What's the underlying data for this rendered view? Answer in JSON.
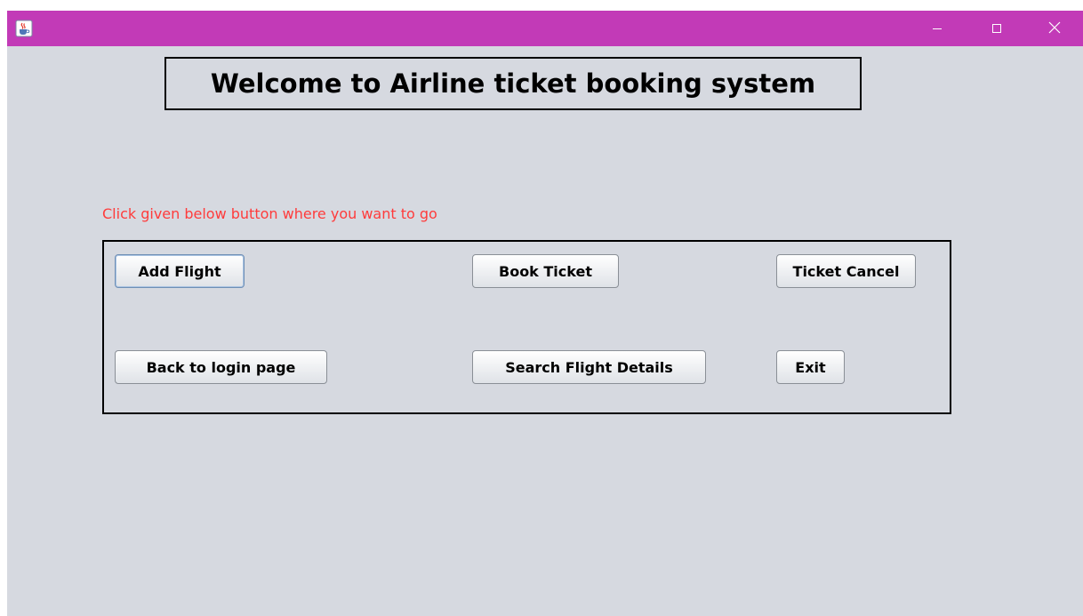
{
  "window": {
    "title": "",
    "titlebar_color": "#c23ab7",
    "background_color": "#d6d9e0",
    "icons": {
      "app": "java-coffee-cup-icon",
      "minimize": "minimize-icon",
      "maximize": "maximize-icon",
      "close": "close-icon"
    }
  },
  "header": {
    "title": "Welcome to Airline ticket booking system"
  },
  "instruction": {
    "text": "Click given below button where you want to go",
    "color": "#ff3b3b"
  },
  "buttons": {
    "add_flight": "Add Flight",
    "book_ticket": "Book Ticket",
    "ticket_cancel": "Ticket Cancel",
    "back_to_login": "Back to login page",
    "search_flight_details": "Search Flight Details",
    "exit": "Exit"
  }
}
